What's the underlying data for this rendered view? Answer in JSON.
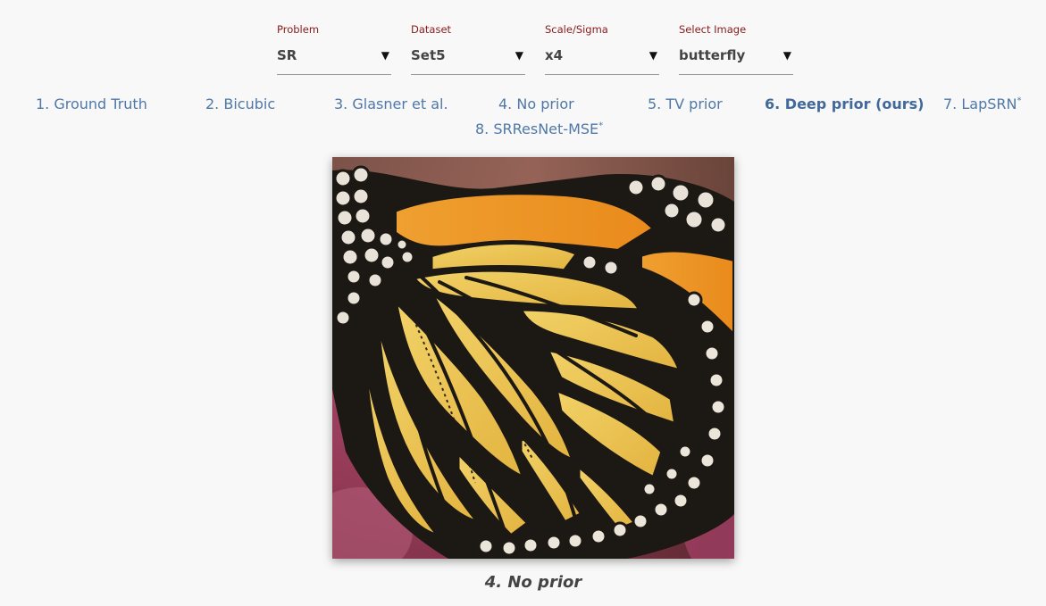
{
  "selectors": [
    {
      "label": "Problem",
      "value": "SR"
    },
    {
      "label": "Dataset",
      "value": "Set5"
    },
    {
      "label": "Scale/Sigma",
      "value": "x4"
    },
    {
      "label": "Select Image",
      "value": "butterfly"
    }
  ],
  "arrow_glyph": "▼",
  "tabs": [
    {
      "label": "1. Ground Truth",
      "sup": ""
    },
    {
      "label": "2. Bicubic",
      "sup": ""
    },
    {
      "label": "3. Glasner et al.",
      "sup": ""
    },
    {
      "label": "4. No prior",
      "sup": ""
    },
    {
      "label": "5. TV prior",
      "sup": ""
    },
    {
      "label": "6. Deep prior (ours)",
      "sup": ""
    },
    {
      "label": "7. LapSRN",
      "sup": "*"
    },
    {
      "label": "8. SRResNet-MSE",
      "sup": "*"
    }
  ],
  "active_tab_index": 5,
  "caption": "4. No prior",
  "colors": {
    "label_red": "#8b1a1a",
    "link_blue": "#4f78a8",
    "background": "#f8f8f8"
  }
}
